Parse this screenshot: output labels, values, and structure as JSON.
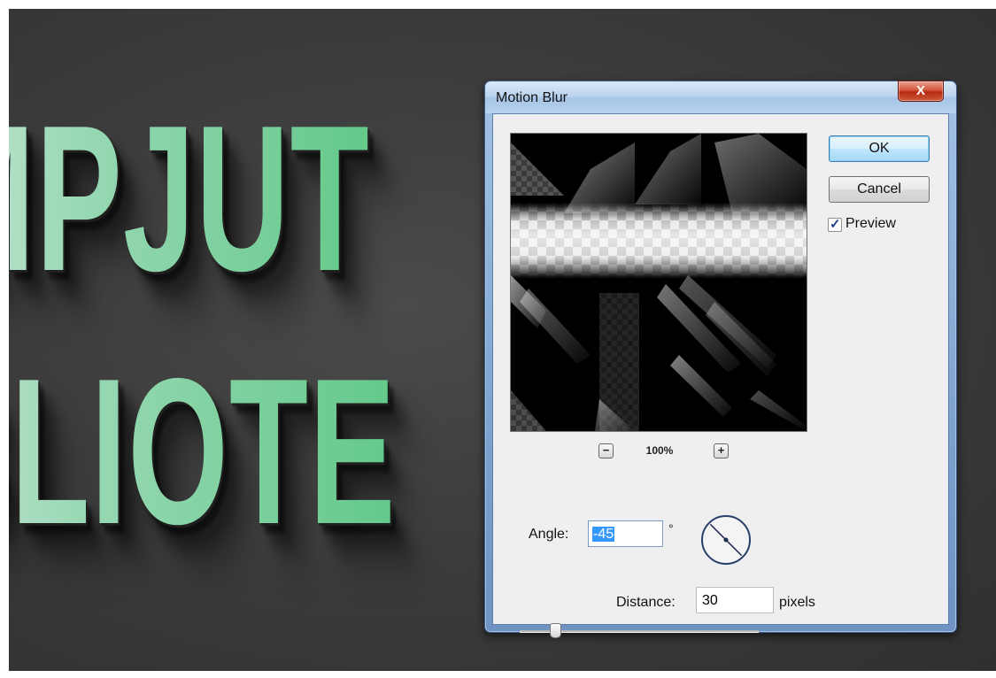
{
  "artwork": {
    "line1": "MPJUT",
    "line2": "BLIOTE"
  },
  "dialog": {
    "title": "Motion Blur",
    "close_glyph": "X",
    "ok_label": "OK",
    "cancel_label": "Cancel",
    "preview_label": "Preview",
    "preview_checked": true,
    "zoom": {
      "out_glyph": "−",
      "level": "100%",
      "in_glyph": "+"
    },
    "angle": {
      "label": "Angle:",
      "value": "-45",
      "unit": "°"
    },
    "distance": {
      "label": "Distance:",
      "value": "30",
      "unit": "pixels",
      "slider_fraction": 0.1
    }
  },
  "icons": [
    "close-icon",
    "zoom-out-icon",
    "zoom-in-icon",
    "checkmark-icon",
    "angle-dial-icon",
    "slider-thumb-icon"
  ],
  "colors": {
    "canvas_bg": "#3a3a3a",
    "text_green": "#63c98a",
    "text_light": "#c9e6d6",
    "close_red": "#c8432a",
    "selection_blue": "#3399ff"
  }
}
